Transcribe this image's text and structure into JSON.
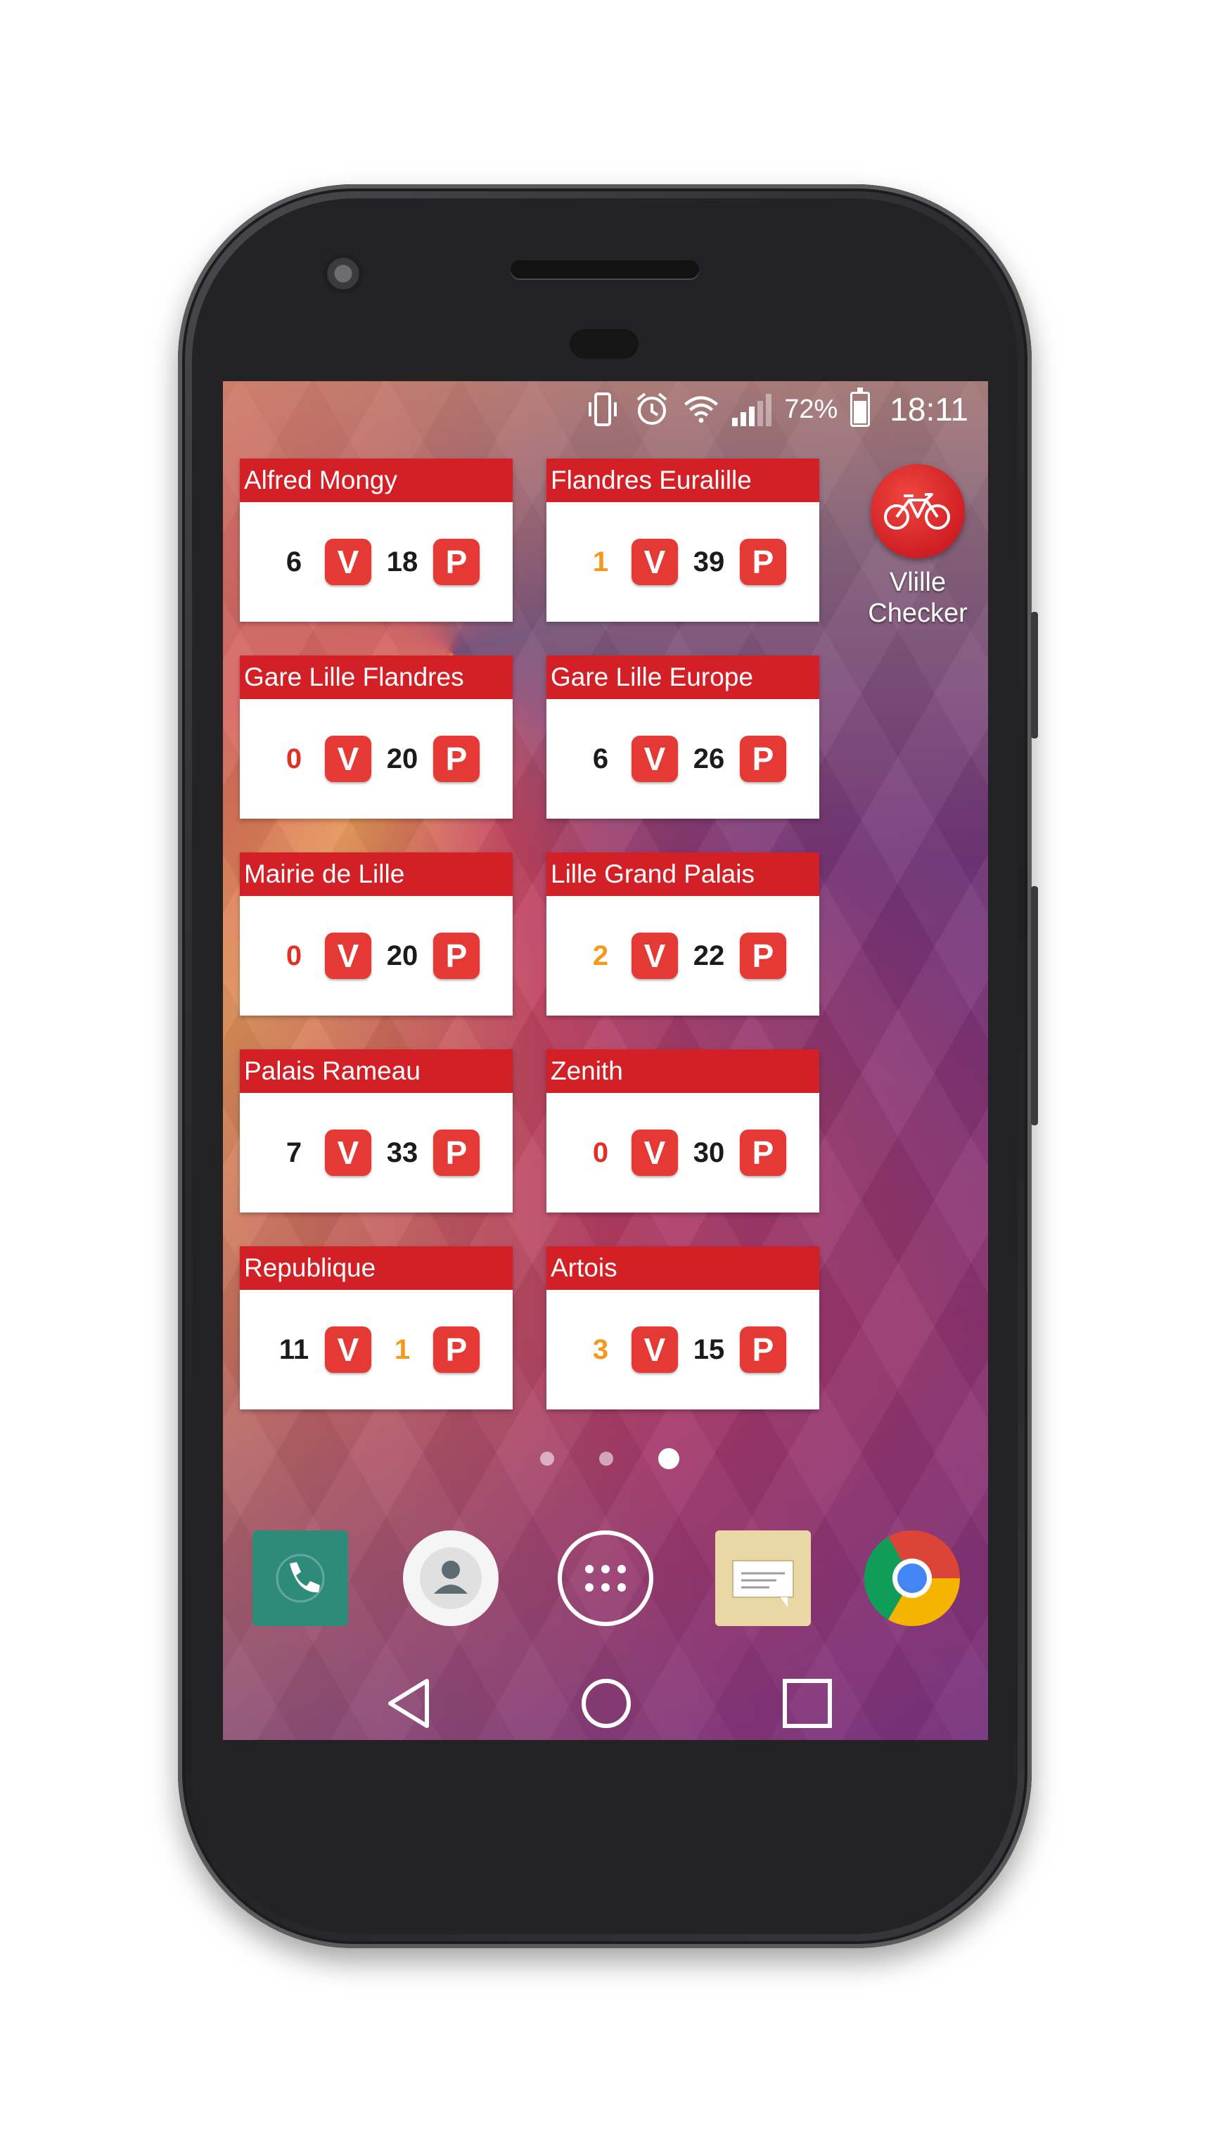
{
  "status_bar": {
    "battery": "72%",
    "time": "18:11",
    "icons": [
      "vibrate-icon",
      "alarm-icon",
      "wifi-icon",
      "signal-icon",
      "battery-icon"
    ]
  },
  "widgets": [
    {
      "station": "Alfred Mongy",
      "bikes": "6",
      "bikes_color": "black",
      "bike_badge": "V",
      "stands": "18",
      "stands_color": "black",
      "stand_badge": "P"
    },
    {
      "station": "Flandres Euralille",
      "bikes": "1",
      "bikes_color": "orange",
      "bike_badge": "V",
      "stands": "39",
      "stands_color": "black",
      "stand_badge": "P"
    },
    {
      "station": "Gare Lille Flandres",
      "bikes": "0",
      "bikes_color": "red",
      "bike_badge": "V",
      "stands": "20",
      "stands_color": "black",
      "stand_badge": "P"
    },
    {
      "station": "Gare Lille Europe",
      "bikes": "6",
      "bikes_color": "black",
      "bike_badge": "V",
      "stands": "26",
      "stands_color": "black",
      "stand_badge": "P"
    },
    {
      "station": "Mairie de Lille",
      "bikes": "0",
      "bikes_color": "red",
      "bike_badge": "V",
      "stands": "20",
      "stands_color": "black",
      "stand_badge": "P"
    },
    {
      "station": "Lille Grand Palais",
      "bikes": "2",
      "bikes_color": "orange",
      "bike_badge": "V",
      "stands": "22",
      "stands_color": "black",
      "stand_badge": "P"
    },
    {
      "station": "Palais Rameau",
      "bikes": "7",
      "bikes_color": "black",
      "bike_badge": "V",
      "stands": "33",
      "stands_color": "black",
      "stand_badge": "P"
    },
    {
      "station": "Zenith",
      "bikes": "0",
      "bikes_color": "red",
      "bike_badge": "V",
      "stands": "30",
      "stands_color": "black",
      "stand_badge": "P"
    },
    {
      "station": "Republique",
      "bikes": "11",
      "bikes_color": "black",
      "bike_badge": "V",
      "stands": "1",
      "stands_color": "orange",
      "stand_badge": "P"
    },
    {
      "station": "Artois",
      "bikes": "3",
      "bikes_color": "orange",
      "bike_badge": "V",
      "stands": "15",
      "stands_color": "black",
      "stand_badge": "P"
    }
  ],
  "app_shortcut": {
    "label_line1": "Vlille",
    "label_line2": "Checker",
    "icon": "bike-icon"
  },
  "page_indicator": {
    "pages": 3,
    "active": 3
  },
  "dock": [
    {
      "name": "phone-app",
      "icon": "phone-icon"
    },
    {
      "name": "contacts-app",
      "icon": "person-icon"
    },
    {
      "name": "app-drawer",
      "icon": "grid-icon"
    },
    {
      "name": "messages-app",
      "icon": "message-icon"
    },
    {
      "name": "chrome-app",
      "icon": "chrome-icon"
    }
  ],
  "navigation": [
    "back-icon",
    "home-icon",
    "recents-icon"
  ],
  "colors": {
    "widget_header": "#d32027",
    "badge": "#e53935",
    "red_count": "#e33027",
    "orange_count": "#f39a1e"
  }
}
